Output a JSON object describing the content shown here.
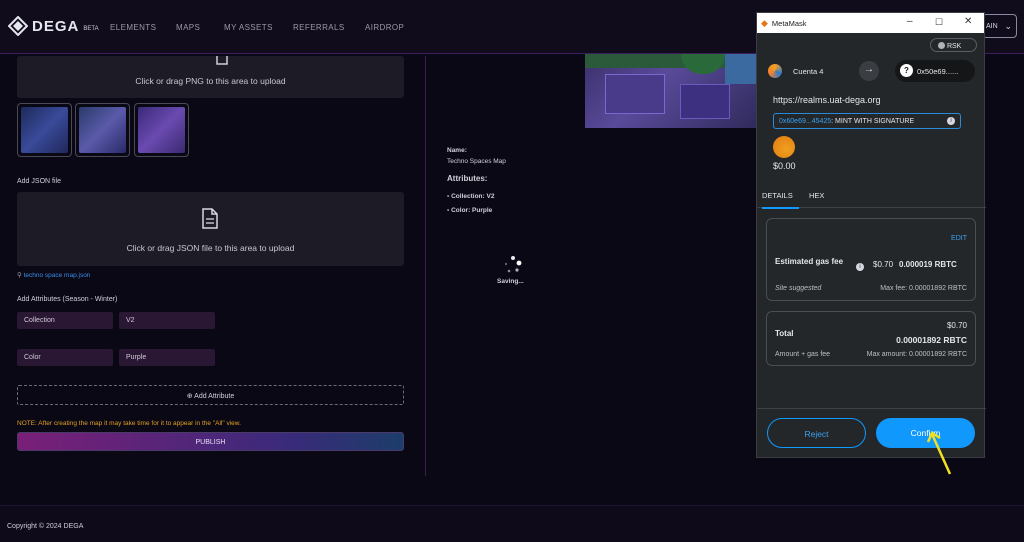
{
  "nav": {
    "logo_text": "DEGA",
    "logo_badge": "BETA",
    "items": [
      "ELEMENTS",
      "MAPS",
      "MY ASSETS",
      "REFERRALS",
      "AIRDROP"
    ],
    "right_chip": "AIN"
  },
  "upload_png": {
    "text": "Click or drag PNG to this area to upload"
  },
  "json_section": {
    "heading": "Add JSON file",
    "text": "Click or drag JSON file to this area to upload",
    "file_name": "techno space map.json"
  },
  "attributes_section": {
    "heading": "Add Attributes (Season - Winter)",
    "rows": [
      {
        "key": "Collection",
        "value": "V2"
      },
      {
        "key": "Color",
        "value": "Purple"
      }
    ],
    "add_label": "Add Attribute"
  },
  "note": "NOTE: After creating the map it may take time for it to appear in the \"All\" view.",
  "publish_label": "PUBLISH",
  "preview": {
    "name_label": "Name:",
    "name_value": "Techno Spaces Map",
    "attributes_heading": "Attributes:",
    "attributes": [
      "Collection: V2",
      "Color: Purple"
    ],
    "saving_text": "Saving..."
  },
  "footer": {
    "copyright": "Copyright © 2024 DEGA"
  },
  "metamask": {
    "window_title": "MetaMask",
    "network": "RSK",
    "account_name": "Cuenta 4",
    "to_address": "0x50e69......",
    "origin": "https://realms.uat-dega.org",
    "contract_chip": "0x60e69...45425",
    "method": ": MINT WITH SIGNATURE",
    "value": "$0.00",
    "tabs": [
      "DETAILS",
      "HEX"
    ],
    "edit_label": "EDIT",
    "gas": {
      "label": "Estimated gas fee",
      "usd": "$0.70",
      "amount": "0.000019 RBTC",
      "suggested": "Site suggested",
      "max_fee": "Max fee: 0.00001892 RBTC"
    },
    "total": {
      "label": "Total",
      "usd": "$0.70",
      "amount": "0.00001892 RBTC",
      "sub_label": "Amount + gas fee",
      "max_amount": "Max amount: 0.00001892 RBTC"
    },
    "reject_label": "Reject",
    "confirm_label": "Confirm",
    "accent": "#1098fc"
  }
}
